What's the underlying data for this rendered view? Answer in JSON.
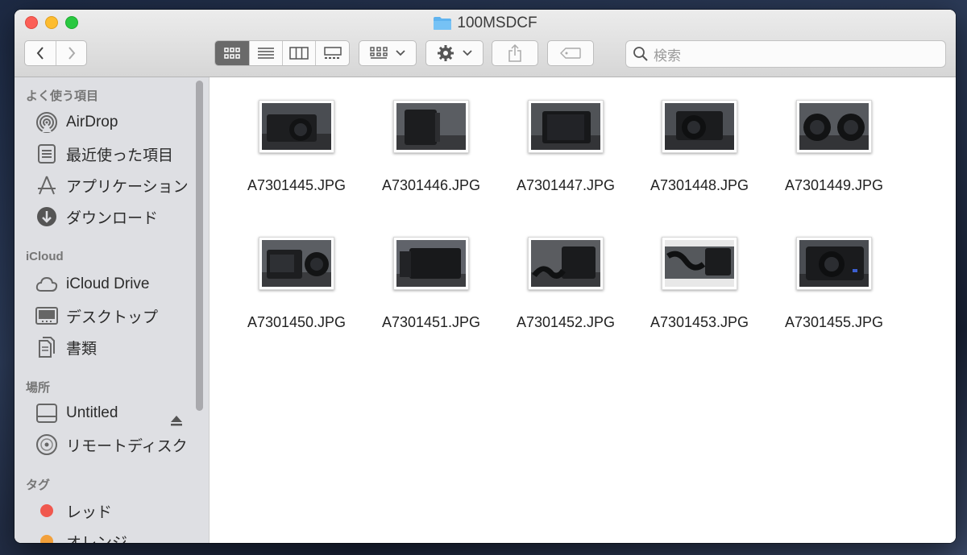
{
  "window": {
    "title": "100MSDCF"
  },
  "toolbar": {
    "back_icon": "chevron-left-icon",
    "forward_icon": "chevron-right-icon",
    "views": [
      "icon-view-icon",
      "list-view-icon",
      "column-view-icon",
      "gallery-view-icon"
    ],
    "group_icon": "group-by-icon",
    "action_icon": "gear-icon",
    "share_icon": "share-icon",
    "tag_icon": "tag-icon"
  },
  "search": {
    "placeholder": "検索"
  },
  "sidebar": {
    "favorites_header": "よく使う項目",
    "favorites": [
      {
        "label": "AirDrop",
        "icon": "airdrop-icon"
      },
      {
        "label": "最近使った項目",
        "icon": "recents-icon"
      },
      {
        "label": "アプリケーション",
        "icon": "applications-icon"
      },
      {
        "label": "ダウンロード",
        "icon": "download-icon"
      }
    ],
    "icloud_header": "iCloud",
    "icloud": [
      {
        "label": "iCloud Drive",
        "icon": "cloud-icon"
      },
      {
        "label": "デスクトップ",
        "icon": "desktop-icon"
      },
      {
        "label": "書類",
        "icon": "documents-icon"
      }
    ],
    "locations_header": "場所",
    "locations": [
      {
        "label": "Untitled",
        "icon": "drive-icon"
      },
      {
        "label": "リモートディスク",
        "icon": "disc-icon"
      }
    ],
    "tags_header": "タグ",
    "tags": [
      {
        "label": "レッド",
        "color": "#f0584e"
      },
      {
        "label": "オレンジ",
        "color": "#f2a03b"
      }
    ]
  },
  "files": [
    {
      "name": "A7301445.JPG"
    },
    {
      "name": "A7301446.JPG"
    },
    {
      "name": "A7301447.JPG"
    },
    {
      "name": "A7301448.JPG"
    },
    {
      "name": "A7301449.JPG"
    },
    {
      "name": "A7301450.JPG"
    },
    {
      "name": "A7301451.JPG"
    },
    {
      "name": "A7301452.JPG"
    },
    {
      "name": "A7301453.JPG"
    },
    {
      "name": "A7301455.JPG"
    }
  ]
}
